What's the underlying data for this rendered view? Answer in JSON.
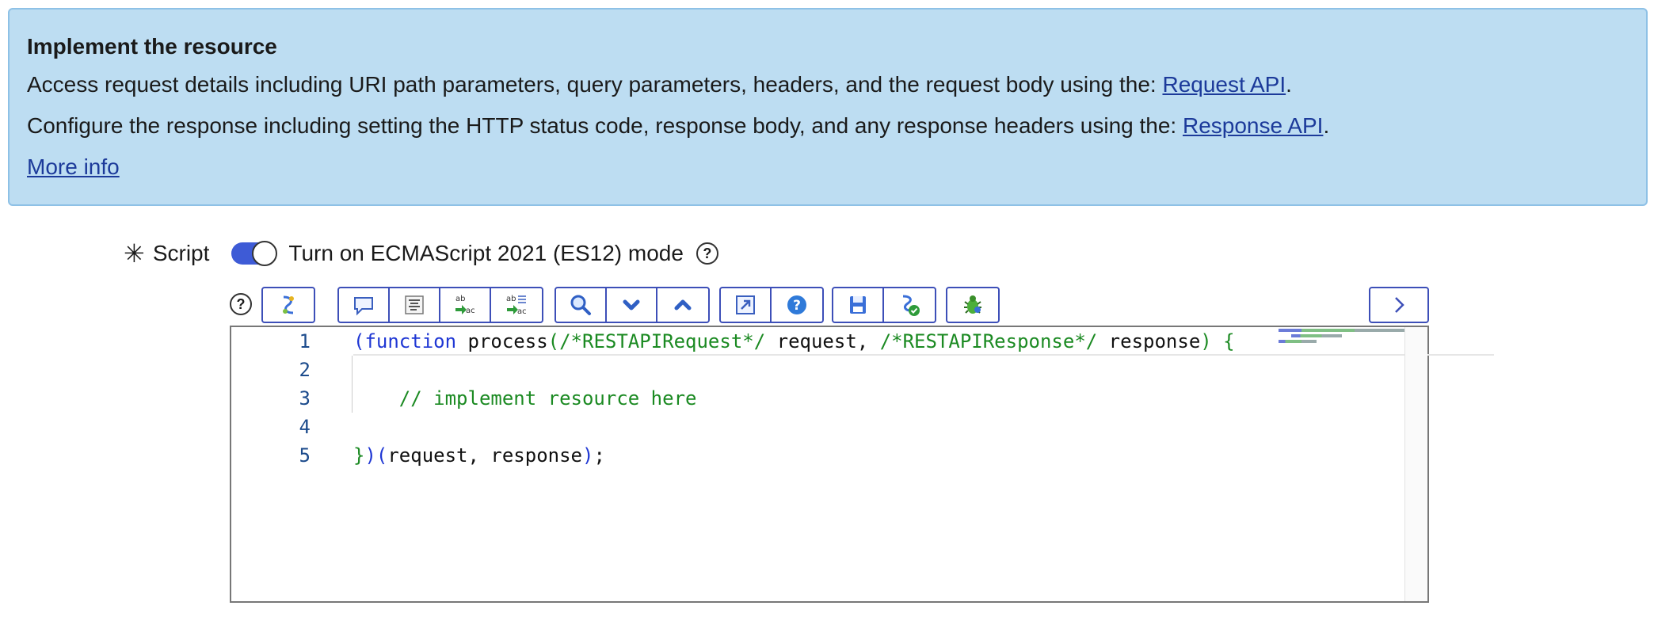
{
  "info": {
    "title": "Implement the resource",
    "line1_text": "Access request details including URI path parameters, query parameters, headers, and the request body using the: ",
    "line1_link": "Request API",
    "line1_suffix": ".",
    "line2_text": "Configure the response including setting the HTTP status code, response body, and any response headers using the: ",
    "line2_link": "Response API",
    "line2_suffix": ".",
    "more_info": "More info"
  },
  "script_field": {
    "required_marker": "✳",
    "label": "Script",
    "toggle_label": "Turn on ECMAScript 2021 (ES12) mode",
    "toggle_on": true,
    "help_glyph": "?"
  },
  "toolbar": {
    "help_glyph": "?",
    "buttons": [
      {
        "name": "script-include-icon"
      },
      {
        "name": "comment-icon"
      },
      {
        "name": "format-code-icon"
      },
      {
        "name": "replace-icon"
      },
      {
        "name": "replace-all-icon"
      },
      {
        "name": "search-icon"
      },
      {
        "name": "next-match-icon"
      },
      {
        "name": "previous-match-icon"
      },
      {
        "name": "fullscreen-icon"
      },
      {
        "name": "help-icon"
      },
      {
        "name": "save-icon"
      },
      {
        "name": "syntax-check-icon"
      },
      {
        "name": "debug-icon"
      },
      {
        "name": "expand-right-icon"
      }
    ]
  },
  "editor": {
    "line_numbers": [
      "1",
      "2",
      "3",
      "4",
      "5"
    ],
    "lines": {
      "l1": {
        "open_paren": "(",
        "keyword": "function",
        "name": " process",
        "paren_open": "(",
        "comment1": "/*RESTAPIRequest*/",
        "arg1": " request, ",
        "comment2": "/*RESTAPIResponse*/",
        "arg2": " response",
        "paren_close": ")",
        "brace": " {"
      },
      "l3": {
        "comment": "    // implement resource here"
      },
      "l5": {
        "brace": "}",
        "paren1": ")",
        "paren2": "(",
        "args": "request, response",
        "paren3": ")",
        "semi": ";"
      }
    }
  },
  "colors": {
    "info_bg": "#bdddf2",
    "link": "#1c3a9a",
    "toggle_on": "#3e5bd6",
    "keyword": "#1f37d4",
    "comment": "#1b8a22",
    "toolbar_border": "#3d4fb8"
  }
}
